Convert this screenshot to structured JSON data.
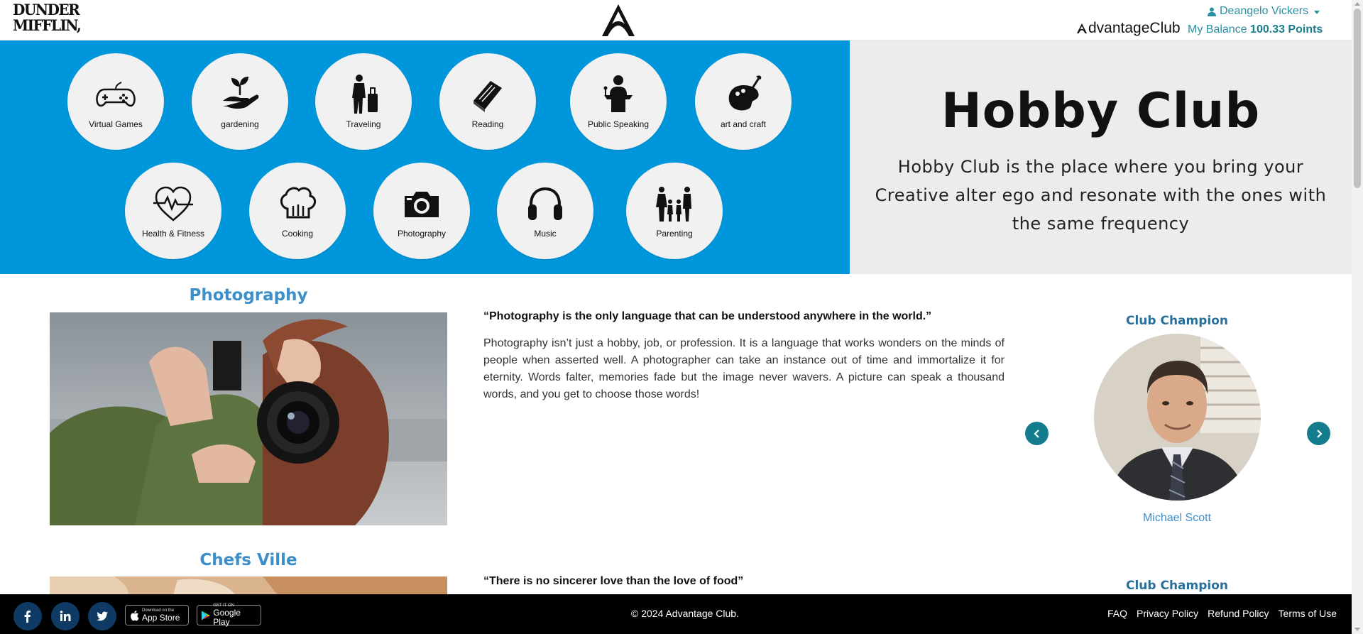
{
  "header": {
    "company_logo_line1": "DUNDER",
    "company_logo_line2": "MIFFLIN,",
    "user_name": "Deangelo Vickers",
    "brand_name": "dvantageClub",
    "balance_label": "My Balance",
    "balance_value": "100.33 Points"
  },
  "banner": {
    "title": "Hobby Club",
    "subtitle": "Hobby Club is the place where you bring your Creative alter ego and resonate with the ones with the same frequency",
    "categories": [
      {
        "label": "Virtual Games",
        "icon": "gamepad-icon"
      },
      {
        "label": "gardening",
        "icon": "plant-hand-icon"
      },
      {
        "label": "Traveling",
        "icon": "traveler-icon"
      },
      {
        "label": "Reading",
        "icon": "book-icon"
      },
      {
        "label": "Public Speaking",
        "icon": "podium-icon"
      },
      {
        "label": "art and craft",
        "icon": "palette-icon"
      },
      {
        "label": "Health & Fitness",
        "icon": "heartbeat-icon"
      },
      {
        "label": "Cooking",
        "icon": "chef-hat-icon"
      },
      {
        "label": "Photography",
        "icon": "camera-icon"
      },
      {
        "label": "Music",
        "icon": "headphones-icon"
      },
      {
        "label": "Parenting",
        "icon": "family-icon"
      }
    ]
  },
  "clubs": [
    {
      "title": "Photography",
      "quote": "“Photography is the only language that can be understood anywhere in the world.”",
      "description": "Photography isn’t just a hobby, job, or profession. It is a language that works wonders on the minds of people when asserted well. A photographer can take an instance out of time and immortalize it for eternity. Words falter, memories fade but the image never wavers. A picture can speak a thousand words, and you get to choose those words!",
      "champion_label": "Club Champion",
      "champion_name": "Michael Scott"
    },
    {
      "title": "Chefs Ville",
      "quote": "“There is no sincerer love than the love of food”",
      "champion_label": "Club Champion"
    }
  ],
  "footer": {
    "app_store_small": "Download on the",
    "app_store_big": "App Store",
    "play_store_small": "GET IT ON",
    "play_store_big": "Google Play",
    "copyright": "© 2024 Advantage Club.",
    "links": [
      "FAQ",
      "Privacy Policy",
      "Refund Policy",
      "Terms of Use"
    ]
  },
  "colors": {
    "banner_blue": "#0096db",
    "accent_teal": "#137d8e",
    "title_blue": "#3d8fc9",
    "footer_bg": "#000000"
  }
}
